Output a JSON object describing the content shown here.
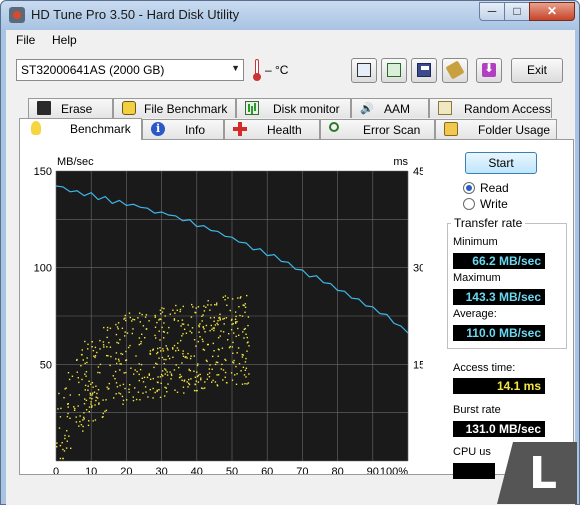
{
  "window": {
    "title": "HD Tune Pro 3.50 - Hard Disk Utility",
    "minimize_glyph": "─",
    "maximize_glyph": "□",
    "close_glyph": "✕"
  },
  "menu": {
    "file": "File",
    "help": "Help"
  },
  "toolbar": {
    "drive": "ST32000641AS (2000 GB)",
    "temperature": "– °C",
    "exit_label": "Exit"
  },
  "tabs_row1": [
    {
      "label": "Erase",
      "icon": "eraser-icon"
    },
    {
      "label": "File Benchmark",
      "icon": "file-benchmark-icon"
    },
    {
      "label": "Disk monitor",
      "icon": "disk-monitor-icon"
    },
    {
      "label": "AAM",
      "icon": "speaker-icon"
    },
    {
      "label": "Random Access",
      "icon": "random-access-icon"
    }
  ],
  "tabs_row2": [
    {
      "label": "Benchmark",
      "icon": "bulb-icon",
      "active": true
    },
    {
      "label": "Info",
      "icon": "info-icon"
    },
    {
      "label": "Health",
      "icon": "health-cross-icon"
    },
    {
      "label": "Error Scan",
      "icon": "magnifier-icon"
    },
    {
      "label": "Folder Usage",
      "icon": "folder-icon"
    }
  ],
  "controls": {
    "start_label": "Start",
    "read_label": "Read",
    "write_label": "Write",
    "selected_mode": "Read"
  },
  "transfer_rate": {
    "title": "Transfer rate",
    "minimum_label": "Minimum",
    "minimum_value": "66.2 MB/sec",
    "maximum_label": "Maximum",
    "maximum_value": "143.3 MB/sec",
    "average_label": "Average:",
    "average_value": "110.0 MB/sec"
  },
  "access_time": {
    "label": "Access time:",
    "value": "14.1 ms"
  },
  "burst_rate": {
    "label": "Burst rate",
    "value": "131.0 MB/sec"
  },
  "cpu_usage": {
    "label": "CPU us",
    "value": ""
  },
  "watermark": {
    "letter": "L"
  },
  "colors": {
    "plot_bg": "#1a1a1a",
    "grid": "#6a6a6a",
    "transfer_line": "#3fb6e8",
    "access_points": "#f5e640",
    "value_cyan": "#6ad8f0",
    "value_yellow": "#f5e640"
  },
  "chart_data": {
    "type": "line",
    "ylabel_left": "MB/sec",
    "ylabel_right": "ms",
    "ylim_left": [
      0,
      150
    ],
    "ylim_right": [
      0,
      45
    ],
    "y_ticks_left": [
      "150",
      "100",
      "50"
    ],
    "y_ticks_right": [
      "45",
      "30",
      "15"
    ],
    "x_ticks": [
      "0",
      "10",
      "20",
      "30",
      "40",
      "50",
      "60",
      "70",
      "80",
      "90",
      "100%"
    ],
    "grid": true,
    "series": [
      {
        "axis": "left",
        "x": [
          0,
          2,
          4,
          6,
          8,
          10,
          12,
          14,
          16,
          18,
          20,
          22,
          24,
          26,
          28,
          30,
          32,
          34,
          36,
          38,
          40,
          42,
          44,
          46,
          48,
          50,
          52,
          54,
          56,
          58,
          60,
          62,
          64,
          66,
          68,
          70,
          72,
          74,
          76,
          78,
          80,
          82,
          84,
          86,
          88,
          90,
          92,
          94,
          96,
          98,
          100
        ],
        "values": [
          143,
          141,
          140,
          139,
          138,
          138,
          136,
          136,
          134,
          134,
          133,
          132,
          132,
          130,
          129,
          128,
          128,
          126,
          125,
          124,
          122,
          121,
          120,
          118,
          117,
          115,
          114,
          112,
          110,
          109,
          107,
          106,
          104,
          102,
          100,
          98,
          96,
          95,
          93,
          91,
          89,
          87,
          85,
          83,
          81,
          79,
          77,
          75,
          72,
          69,
          67
        ]
      }
    ],
    "access_scatter": {
      "axis": "right",
      "description_x_range": [
        0,
        55
      ],
      "trend_ms": [
        [
          0,
          3
        ],
        [
          5,
          10
        ],
        [
          10,
          13
        ],
        [
          20,
          16
        ],
        [
          30,
          17
        ],
        [
          40,
          18
        ],
        [
          50,
          19
        ]
      ]
    }
  }
}
